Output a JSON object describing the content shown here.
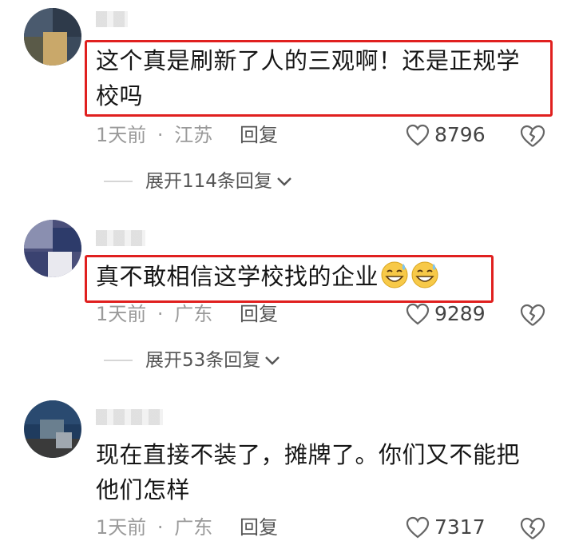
{
  "comments": [
    {
      "text_line1": "这个真是刷新了人的三观啊！还是正规学",
      "text_line2": "校吗",
      "time": "1天前",
      "dot": "·",
      "location": "江苏",
      "reply_label": "回复",
      "likes": "8796",
      "expand_label": "展开114条回复",
      "avatar_colors": [
        "#3b4a5c",
        "#c9a86a",
        "#5a5a48",
        "#2e3a4a"
      ]
    },
    {
      "text_line1": "真不敢相信这学校找的企业",
      "emojis": [
        "sweat-grin-emoji",
        "sweat-grin-emoji"
      ],
      "time": "1天前",
      "dot": "·",
      "location": "广东",
      "reply_label": "回复",
      "likes": "9289",
      "expand_label": "展开53条回复",
      "avatar_colors": [
        "#4a4f7a",
        "#e9e9ef",
        "#2d3b6a",
        "#8a8fb0"
      ]
    },
    {
      "text_line1": "现在直接不装了，摊牌了。你们又不能把",
      "text_line2": "他们怎样",
      "time": "1天前",
      "dot": "·",
      "location": "广东",
      "reply_label": "回复",
      "likes": "7317",
      "avatar_colors": [
        "#1f3b5e",
        "#6a7f8f",
        "#3a3a3a",
        "#a0a8b0"
      ]
    }
  ],
  "colors": {
    "highlight": "#e0201f",
    "meta": "#9a9a9a",
    "text": "#161616"
  }
}
